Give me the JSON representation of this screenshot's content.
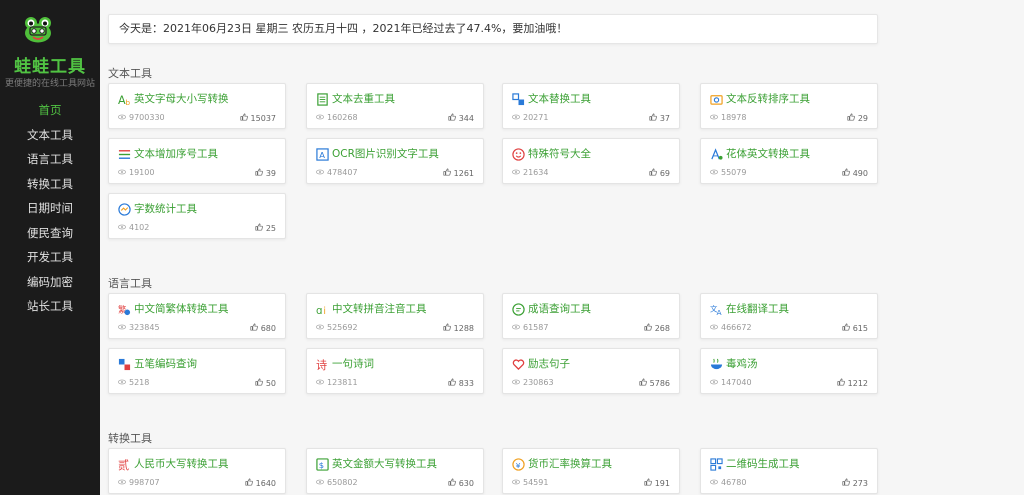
{
  "sidebar": {
    "brand": "蛙蛙工具",
    "slogan": "更便捷的在线工具网站",
    "nav": [
      "首页",
      "文本工具",
      "语言工具",
      "转换工具",
      "日期时间",
      "便民查询",
      "开发工具",
      "编码加密",
      "站长工具"
    ],
    "active_index": 0,
    "accent_color": "#51c343"
  },
  "date_bar": "今天是：2021年06月23日 星期三 农历五月十四 ，2021年已经过去了47.4%，要加油哦！",
  "sections": [
    {
      "title": "文本工具",
      "cards": [
        {
          "title": "英文字母大小写转换",
          "views": "9700330",
          "likes": "15037",
          "icon": "letter-case-icon"
        },
        {
          "title": "文本去重工具",
          "views": "160268",
          "likes": "344",
          "icon": "document-icon"
        },
        {
          "title": "文本替换工具",
          "views": "20271",
          "likes": "37",
          "icon": "replace-icon"
        },
        {
          "title": "文本反转排序工具",
          "views": "18978",
          "likes": "29",
          "icon": "reverse-icon"
        },
        {
          "title": "文本增加序号工具",
          "views": "19100",
          "likes": "39",
          "icon": "numbered-list-icon"
        },
        {
          "title": "OCR图片识别文字工具",
          "views": "478407",
          "likes": "1261",
          "icon": "ocr-icon"
        },
        {
          "title": "特殊符号大全",
          "views": "21634",
          "likes": "69",
          "icon": "smiley-icon"
        },
        {
          "title": "花体英文转换工具",
          "views": "55079",
          "likes": "490",
          "icon": "fancy-font-icon"
        },
        {
          "title": "字数统计工具",
          "views": "4102",
          "likes": "25",
          "icon": "word-count-icon"
        }
      ]
    },
    {
      "title": "语言工具",
      "cards": [
        {
          "title": "中文简繁体转换工具",
          "views": "323845",
          "likes": "680",
          "icon": "traditional-chinese-icon"
        },
        {
          "title": "中文转拼音注音工具",
          "views": "525692",
          "likes": "1288",
          "icon": "pinyin-icon"
        },
        {
          "title": "成语查询工具",
          "views": "61587",
          "likes": "268",
          "icon": "idiom-icon"
        },
        {
          "title": "在线翻译工具",
          "views": "466672",
          "likes": "615",
          "icon": "translate-icon"
        },
        {
          "title": "五笔编码查询",
          "views": "5218",
          "likes": "50",
          "icon": "wubi-icon"
        },
        {
          "title": "一句诗词",
          "views": "123811",
          "likes": "833",
          "icon": "poem-icon"
        },
        {
          "title": "励志句子",
          "views": "230863",
          "likes": "5786",
          "icon": "heart-icon"
        },
        {
          "title": "毒鸡汤",
          "views": "147040",
          "likes": "1212",
          "icon": "soup-bowl-icon"
        }
      ]
    },
    {
      "title": "转换工具",
      "cards": [
        {
          "title": "人民币大写转换工具",
          "views": "998707",
          "likes": "1640",
          "icon": "rmb-uppercase-icon"
        },
        {
          "title": "英文金额大写转换工具",
          "views": "650802",
          "likes": "630",
          "icon": "english-amount-icon"
        },
        {
          "title": "货币汇率换算工具",
          "views": "54591",
          "likes": "191",
          "icon": "currency-icon"
        },
        {
          "title": "二维码生成工具",
          "views": "46780",
          "likes": "273",
          "icon": "qr-code-icon"
        }
      ]
    }
  ]
}
